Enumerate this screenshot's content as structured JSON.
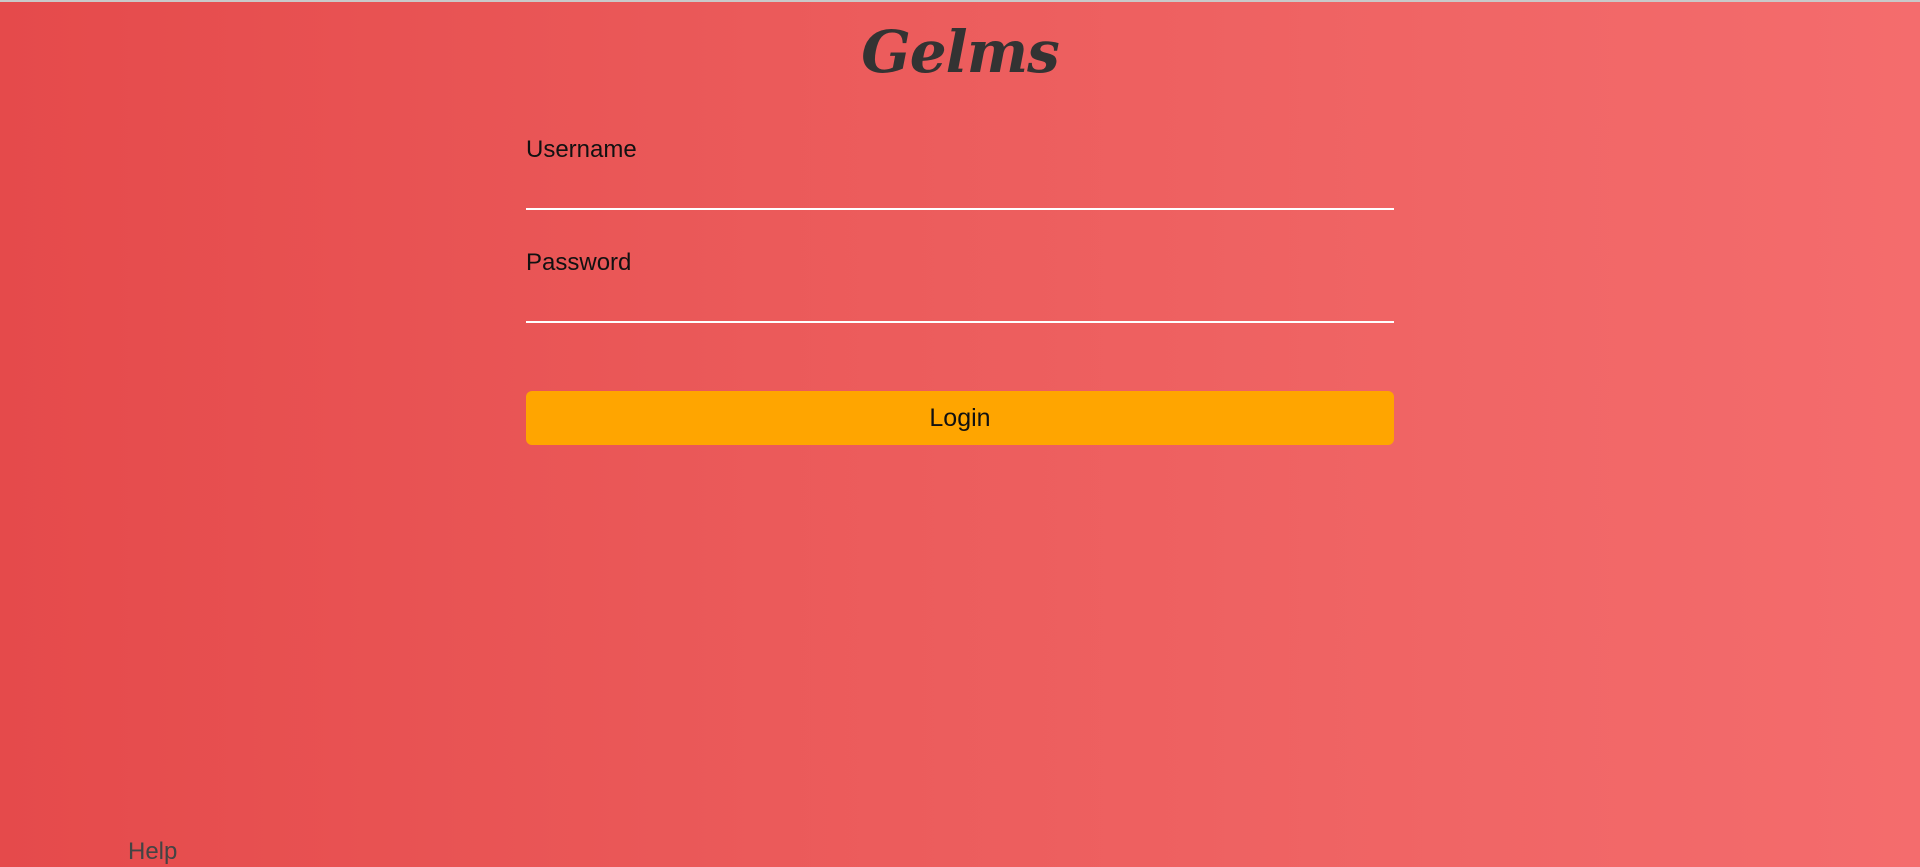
{
  "app": {
    "logo_text": "Gelms"
  },
  "login_form": {
    "username_label": "Username",
    "username_value": "",
    "password_label": "Password",
    "password_value": "",
    "login_button_label": "Login"
  },
  "footer": {
    "help_link": "Help"
  },
  "colors": {
    "background_start": "#e54a4b",
    "background_end": "#f46c6d",
    "button": "#ffa500",
    "input_underline": "#ffffff",
    "logo": "#333333"
  }
}
